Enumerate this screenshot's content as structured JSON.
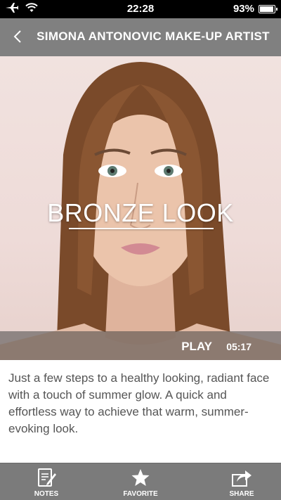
{
  "status_bar": {
    "time": "22:28",
    "battery": "93%",
    "battery_level": 0.93
  },
  "nav": {
    "back_icon": "chevron-left-icon",
    "title": "SIMONA ANTONOVIC MAKE-UP ARTIST"
  },
  "hero": {
    "title": "BRONZE LOOK",
    "play_label": "PLAY",
    "duration": "05:17"
  },
  "description": "Just a few steps to a healthy looking, radiant face with a touch of summer glow. A quick and effortless way to achieve that warm, summer-evoking look.",
  "tabs": [
    {
      "label": "NOTES",
      "icon": "notes-icon"
    },
    {
      "label": "FAVORITE",
      "icon": "star-icon"
    },
    {
      "label": "SHARE",
      "icon": "share-icon"
    }
  ],
  "colors": {
    "nav_bg": "#808080",
    "tab_bg": "#7b7b7b",
    "text": "#555555"
  }
}
